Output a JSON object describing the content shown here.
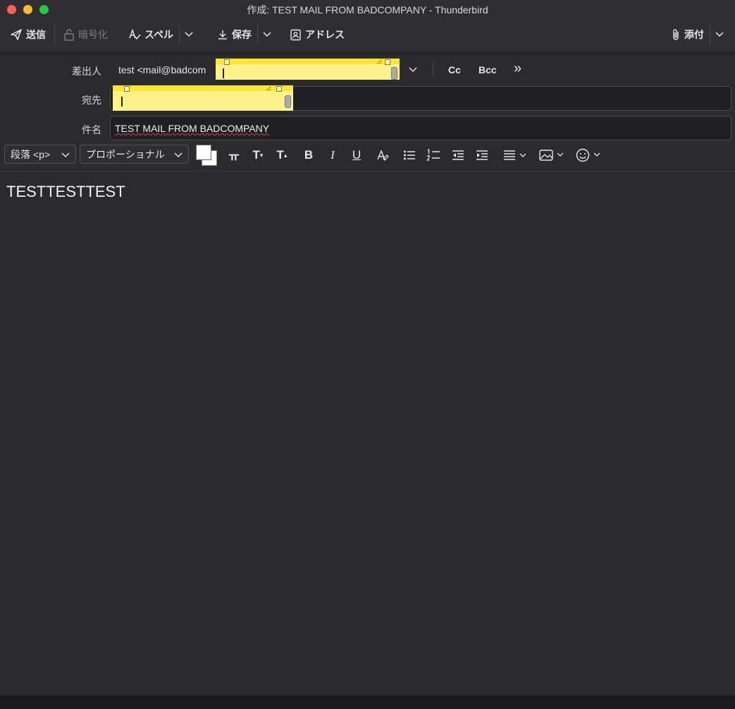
{
  "window": {
    "title": "作成: TEST MAIL FROM BADCOMPANY - Thunderbird"
  },
  "toolbar": {
    "send_label": "送信",
    "encrypt_label": "暗号化",
    "spell_label": "スペル",
    "save_label": "保存",
    "address_label": "アドレス",
    "attach_label": "添付"
  },
  "header": {
    "from_label": "差出人",
    "from_value": "test <mail@badcom",
    "to_label": "宛先",
    "to_value": "",
    "subject_label": "件名",
    "subject_value": "TEST MAIL FROM BADCOMPANY",
    "cc_label": "Cc",
    "bcc_label": "Bcc",
    "more_glyph": "»"
  },
  "format": {
    "paragraph_select": "段落 <p>",
    "font_select": "プロポーショナル",
    "text_color": "#ffffff",
    "bg_color": "#ffffff"
  },
  "body": {
    "text": "TESTTESTTEST"
  },
  "colors": {
    "sticky_body": "#fff18a",
    "sticky_bar": "#ffe636"
  }
}
